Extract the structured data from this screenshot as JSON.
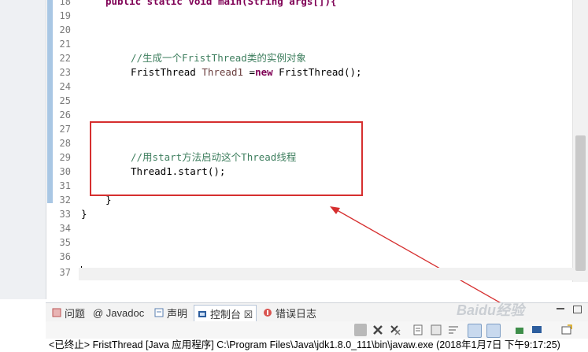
{
  "editor": {
    "lines": [
      {
        "n": "18",
        "text": "public static void main(String args[]){",
        "type": "partial"
      },
      {
        "n": "19",
        "text": ""
      },
      {
        "n": "20",
        "text": ""
      },
      {
        "n": "21",
        "text": ""
      },
      {
        "n": "22",
        "text": "//生成一个FristThread类的实例对象",
        "type": "comment"
      },
      {
        "n": "23",
        "text": "FristThread Thread1 =new FristThread();",
        "type": "code"
      },
      {
        "n": "24",
        "text": ""
      },
      {
        "n": "25",
        "text": ""
      },
      {
        "n": "26",
        "text": ""
      },
      {
        "n": "27",
        "text": ""
      },
      {
        "n": "28",
        "text": ""
      },
      {
        "n": "29",
        "text": "//用start方法启动这个Thread线程",
        "type": "comment"
      },
      {
        "n": "30",
        "text": "Thread1.start();",
        "type": "code"
      },
      {
        "n": "31",
        "text": ""
      },
      {
        "n": "32",
        "text": "}",
        "type": "code"
      },
      {
        "n": "33",
        "text": "}",
        "type": "code"
      },
      {
        "n": "34",
        "text": ""
      },
      {
        "n": "35",
        "text": ""
      },
      {
        "n": "36",
        "text": ""
      },
      {
        "n": "37",
        "text": ""
      }
    ],
    "code": {
      "line18": "public static void main(String args[]){",
      "line22": "//生成一个FristThread类的实例对象",
      "line23_type": "FristThread ",
      "line23_var": "Thread1",
      "line23_assign": " =",
      "line23_new": "new",
      "line23_rest": " FristThread();",
      "line29": "//用start方法启动这个Thread线程",
      "line30": "Thread1.start();",
      "line32": "}",
      "line33": "}"
    }
  },
  "view_tabs": [
    {
      "label": "问题",
      "icon": "problems-icon"
    },
    {
      "label": "@ Javadoc",
      "icon": "javadoc-icon"
    },
    {
      "label": "声明",
      "icon": "declaration-icon"
    },
    {
      "label": "控制台 ☒",
      "icon": "console-icon",
      "active": true
    },
    {
      "label": "错误日志",
      "icon": "error-log-icon"
    }
  ],
  "console": {
    "status": "<已终止> FristThread [Java 应用程序] C:\\Program Files\\Java\\jdk1.8.0_111\\bin\\javaw.exe (2018年1月7日 下午9:17:25)"
  },
  "watermark": {
    "text": "Baidu经验"
  },
  "colors": {
    "highlight_box": "#d62f2f",
    "comment": "#3f7f5f",
    "keyword": "#7f0055"
  }
}
